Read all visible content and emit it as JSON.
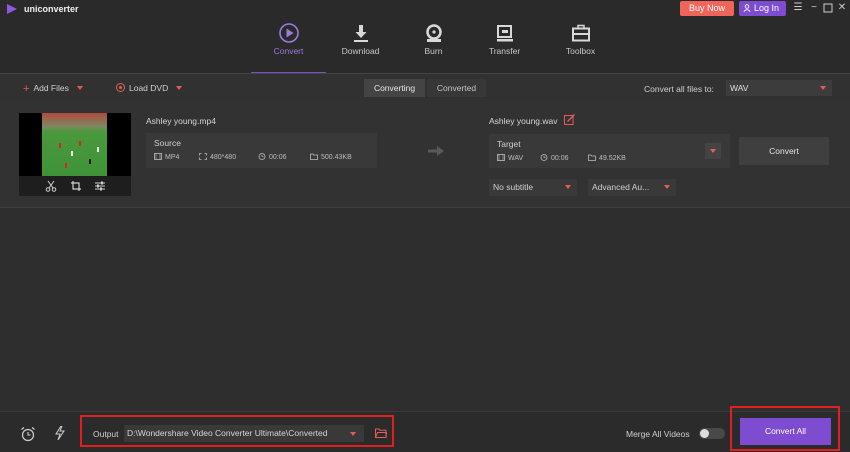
{
  "app": {
    "title": "uniconverter"
  },
  "titlebar": {
    "buy_label": "Buy Now",
    "login_label": "Log In"
  },
  "nav": {
    "tabs": [
      {
        "label": "Convert",
        "icon": "convert-icon",
        "active": true
      },
      {
        "label": "Download",
        "icon": "download-icon"
      },
      {
        "label": "Burn",
        "icon": "burn-icon"
      },
      {
        "label": "Transfer",
        "icon": "transfer-icon"
      },
      {
        "label": "Toolbox",
        "icon": "toolbox-icon"
      }
    ]
  },
  "toolbar": {
    "add_files_label": "Add Files",
    "load_dvd_label": "Load DVD",
    "tabs": {
      "converting": "Converting",
      "converted": "Converted"
    },
    "convert_all_to_label": "Convert all files to:",
    "format_value": "WAV"
  },
  "file": {
    "source": {
      "name": "Ashley young.mp4",
      "title": "Source",
      "format": "MP4",
      "resolution": "480*480",
      "duration": "00:06",
      "size": "500.43KB"
    },
    "target": {
      "name": "Ashley young.wav",
      "title": "Target",
      "format": "WAV",
      "duration": "00:06",
      "size": "49.52KB"
    },
    "convert_label": "Convert",
    "subtitle_value": "No subtitle",
    "audio_value": "Advanced Au..."
  },
  "bottom": {
    "output_label": "Output",
    "output_path": "D:\\Wondershare Video Converter Ultimate\\Converted",
    "merge_label": "Merge All Videos",
    "merge_enabled": false,
    "convert_all_label": "Convert All"
  },
  "colors": {
    "accent": "#7e4cd1",
    "buy": "#f0645a",
    "highlight_frame": "#e02020",
    "caret": "#e25f55"
  }
}
